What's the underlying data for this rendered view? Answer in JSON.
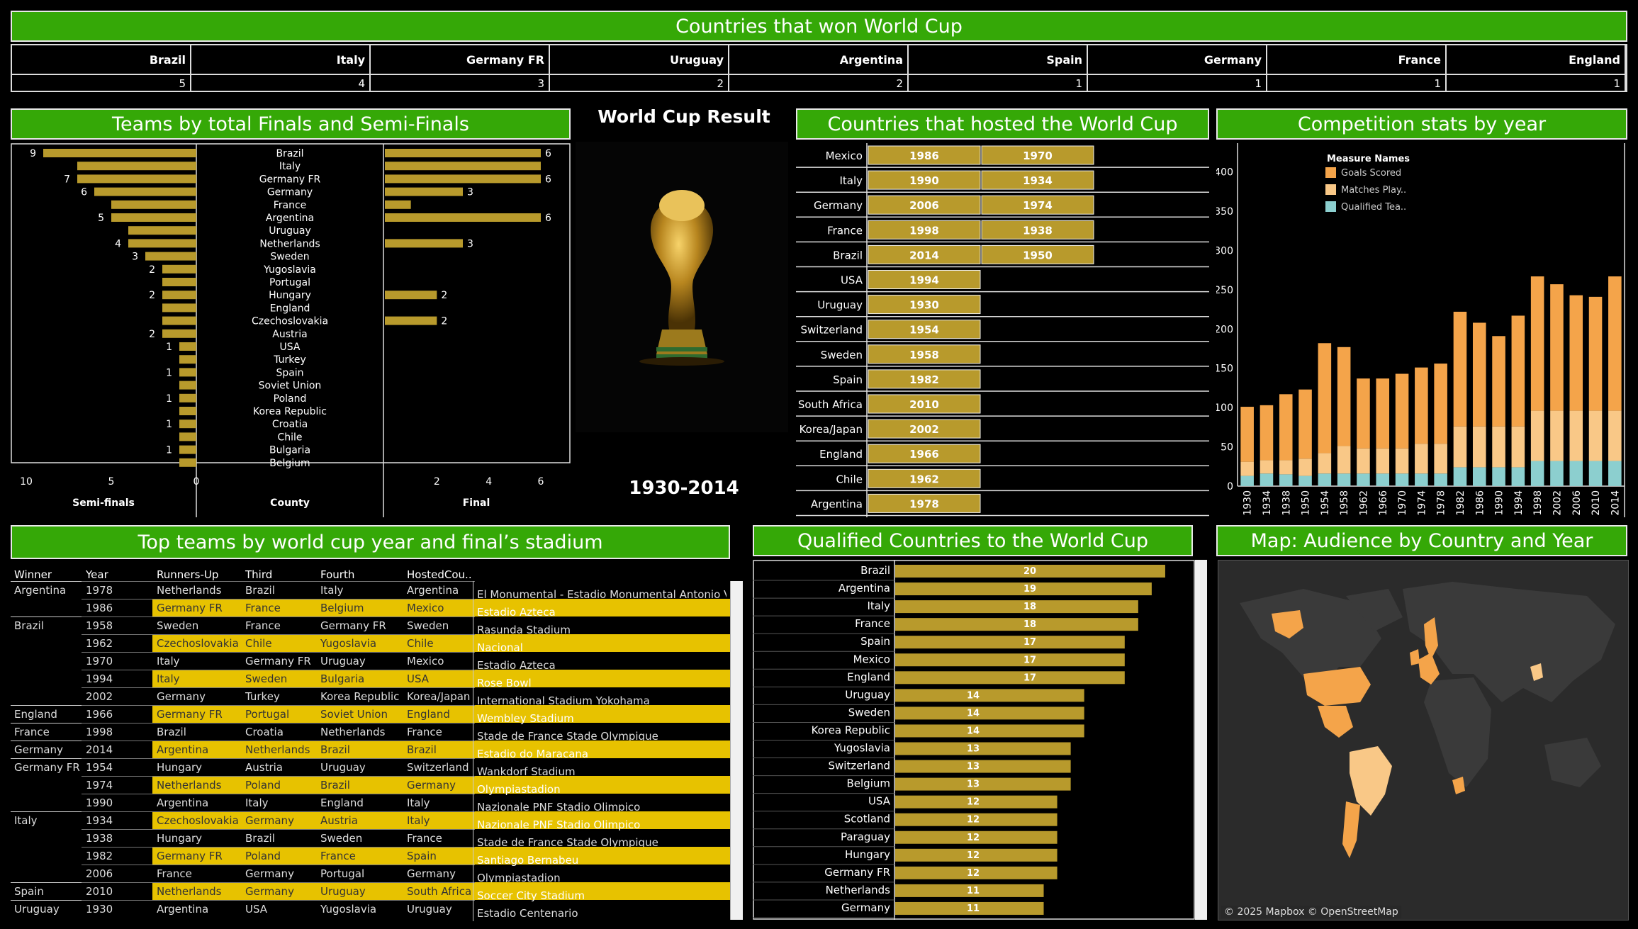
{
  "banners": {
    "won": "Countries that won World Cup",
    "finals": "Teams by total Finals and Semi-Finals",
    "hosted": "Countries that hosted the World Cup",
    "stats": "Competition stats by year",
    "topteams": "Top teams by world cup year and final’s stadium",
    "qualified": "Qualified Countries to the World Cup",
    "map": "Map: Audience by Country and Year"
  },
  "winners": [
    {
      "country": "Brazil",
      "titles": "5"
    },
    {
      "country": "Italy",
      "titles": "4"
    },
    {
      "country": "Germany FR",
      "titles": "3"
    },
    {
      "country": "Uruguay",
      "titles": "2"
    },
    {
      "country": "Argentina",
      "titles": "2"
    },
    {
      "country": "Spain",
      "titles": "1"
    },
    {
      "country": "Germany",
      "titles": "1"
    },
    {
      "country": "France",
      "titles": "1"
    },
    {
      "country": "England",
      "titles": "1"
    }
  ],
  "world_cup_result": {
    "title": "World Cup Result",
    "years": "1930-2014"
  },
  "map": {
    "credit": "© 2025 Mapbox © OpenStreetMap"
  },
  "top_teams": {
    "headers": [
      "Winner",
      "Year",
      "Runners-Up",
      "Third",
      "Fourth",
      "HostedCou.."
    ],
    "rows": [
      {
        "winner": "Argentina",
        "year": "1978",
        "runner": "Netherlands",
        "third": "Brazil",
        "fourth": "Italy",
        "host": "Argentina",
        "stadium": "El Monumental - Estadio Monumental Antonio V...",
        "hl": false,
        "sep": true
      },
      {
        "winner": "",
        "year": "1986",
        "runner": "Germany FR",
        "third": "France",
        "fourth": "Belgium",
        "host": "Mexico",
        "stadium": "Estadio Azteca",
        "hl": true,
        "sep": false
      },
      {
        "winner": "Brazil",
        "year": "1958",
        "runner": "Sweden",
        "third": "France",
        "fourth": "Germany FR",
        "host": "Sweden",
        "stadium": "Rasunda Stadium",
        "hl": false,
        "sep": true
      },
      {
        "winner": "",
        "year": "1962",
        "runner": "Czechoslovakia",
        "third": "Chile",
        "fourth": "Yugoslavia",
        "host": "Chile",
        "stadium": "Nacional",
        "hl": true,
        "sep": false
      },
      {
        "winner": "",
        "year": "1970",
        "runner": "Italy",
        "third": "Germany FR",
        "fourth": "Uruguay",
        "host": "Mexico",
        "stadium": "Estadio Azteca",
        "hl": false,
        "sep": false
      },
      {
        "winner": "",
        "year": "1994",
        "runner": "Italy",
        "third": "Sweden",
        "fourth": "Bulgaria",
        "host": "USA",
        "stadium": "Rose Bowl",
        "hl": true,
        "sep": false
      },
      {
        "winner": "",
        "year": "2002",
        "runner": "Germany",
        "third": "Turkey",
        "fourth": "Korea Republic",
        "host": "Korea/Japan",
        "stadium": "International Stadium Yokohama",
        "hl": false,
        "sep": false
      },
      {
        "winner": "England",
        "year": "1966",
        "runner": "Germany FR",
        "third": "Portugal",
        "fourth": "Soviet Union",
        "host": "England",
        "stadium": "Wembley Stadium",
        "hl": true,
        "sep": true
      },
      {
        "winner": "France",
        "year": "1998",
        "runner": "Brazil",
        "third": "Croatia",
        "fourth": "Netherlands",
        "host": "France",
        "stadium": "Stade de France  Stade Olympique",
        "hl": false,
        "sep": true
      },
      {
        "winner": "Germany",
        "year": "2014",
        "runner": "Argentina",
        "third": "Netherlands",
        "fourth": "Brazil",
        "host": "Brazil",
        "stadium": "Estadio do Maracana",
        "hl": true,
        "sep": true
      },
      {
        "winner": "Germany FR",
        "year": "1954",
        "runner": "Hungary",
        "third": "Austria",
        "fourth": "Uruguay",
        "host": "Switzerland",
        "stadium": "Wankdorf Stadium",
        "hl": false,
        "sep": true
      },
      {
        "winner": "",
        "year": "1974",
        "runner": "Netherlands",
        "third": "Poland",
        "fourth": "Brazil",
        "host": "Germany",
        "stadium": "Olympiastadion",
        "hl": true,
        "sep": false
      },
      {
        "winner": "",
        "year": "1990",
        "runner": "Argentina",
        "third": "Italy",
        "fourth": "England",
        "host": "Italy",
        "stadium": "Nazionale PNF  Stadio Olimpico",
        "hl": false,
        "sep": false
      },
      {
        "winner": "Italy",
        "year": "1934",
        "runner": "Czechoslovakia",
        "third": "Germany",
        "fourth": "Austria",
        "host": "Italy",
        "stadium": "Nazionale PNF  Stadio Olimpico",
        "hl": true,
        "sep": true
      },
      {
        "winner": "",
        "year": "1938",
        "runner": "Hungary",
        "third": "Brazil",
        "fourth": "Sweden",
        "host": "France",
        "stadium": "Stade de France  Stade Olympique",
        "hl": false,
        "sep": false
      },
      {
        "winner": "",
        "year": "1982",
        "runner": "Germany FR",
        "third": "Poland",
        "fourth": "France",
        "host": "Spain",
        "stadium": "Santiago Bernabeu",
        "hl": true,
        "sep": false
      },
      {
        "winner": "",
        "year": "2006",
        "runner": "France",
        "third": "Germany",
        "fourth": "Portugal",
        "host": "Germany",
        "stadium": "Olympiastadion",
        "hl": false,
        "sep": false
      },
      {
        "winner": "Spain",
        "year": "2010",
        "runner": "Netherlands",
        "third": "Germany",
        "fourth": "Uruguay",
        "host": "South Africa",
        "stadium": "Soccer City Stadium",
        "hl": true,
        "sep": true
      },
      {
        "winner": "Uruguay",
        "year": "1930",
        "runner": "Argentina",
        "third": "USA",
        "fourth": "Yugoslavia",
        "host": "Uruguay",
        "stadium": "Estadio Centenario",
        "hl": false,
        "sep": true
      }
    ]
  },
  "chart_data": [
    {
      "type": "bar",
      "title": "Teams by total Finals and Semi-Finals",
      "xlabel_left": "Semi-finals",
      "xlabel_mid": "County",
      "xlabel_right": "Final",
      "categories": [
        "Brazil",
        "Italy",
        "Germany FR",
        "Germany",
        "France",
        "Argentina",
        "Uruguay",
        "Netherlands",
        "Sweden",
        "Yugoslavia",
        "Portugal",
        "Hungary",
        "England",
        "Czechoslovakia",
        "Austria",
        "USA",
        "Turkey",
        "Spain",
        "Soviet Union",
        "Poland",
        "Korea Republic",
        "Croatia",
        "Chile",
        "Bulgaria",
        "Belgium"
      ],
      "series": [
        {
          "name": "Semi-finals",
          "values": [
            9,
            7,
            7,
            6,
            5,
            5,
            4,
            4,
            3,
            2,
            2,
            2,
            2,
            2,
            2,
            1,
            1,
            1,
            1,
            1,
            1,
            1,
            1,
            1,
            1
          ],
          "labels": [
            "9",
            "",
            "7",
            "6",
            "",
            "5",
            "",
            "4",
            "3",
            "2",
            "",
            "2",
            "",
            "",
            "2",
            "1",
            "",
            "1",
            "",
            "1",
            "",
            "1",
            "",
            "1",
            ""
          ]
        },
        {
          "name": "Final",
          "values": [
            6,
            6,
            6,
            3,
            1,
            6,
            0,
            3,
            0,
            0,
            0,
            2,
            0,
            2,
            0,
            0,
            0,
            0,
            0,
            0,
            0,
            0,
            0,
            0,
            0
          ],
          "labels": [
            "6",
            "",
            "6",
            "3",
            "",
            "6",
            "",
            "3",
            "",
            "",
            "",
            "2",
            "",
            "2",
            "",
            "",
            "",
            "",
            "",
            "",
            "",
            "",
            "",
            "",
            ""
          ]
        }
      ],
      "xticks_left": [
        "10",
        "5",
        "0"
      ],
      "xlim_left": [
        0,
        10
      ],
      "xticks_right": [
        "2",
        "4",
        "6"
      ],
      "xlim_right": [
        0,
        6
      ]
    },
    {
      "type": "table",
      "title": "Countries that hosted the World Cup",
      "rows": [
        {
          "country": "Mexico",
          "years": [
            "1986",
            "1970"
          ]
        },
        {
          "country": "Italy",
          "years": [
            "1990",
            "1934"
          ]
        },
        {
          "country": "Germany",
          "years": [
            "2006",
            "1974"
          ]
        },
        {
          "country": "France",
          "years": [
            "1998",
            "1938"
          ]
        },
        {
          "country": "Brazil",
          "years": [
            "2014",
            "1950"
          ]
        },
        {
          "country": "USA",
          "years": [
            "1994"
          ]
        },
        {
          "country": "Uruguay",
          "years": [
            "1930"
          ]
        },
        {
          "country": "Switzerland",
          "years": [
            "1954"
          ]
        },
        {
          "country": "Sweden",
          "years": [
            "1958"
          ]
        },
        {
          "country": "Spain",
          "years": [
            "1982"
          ]
        },
        {
          "country": "South Africa",
          "years": [
            "2010"
          ]
        },
        {
          "country": "Korea/Japan",
          "years": [
            "2002"
          ]
        },
        {
          "country": "England",
          "years": [
            "1966"
          ]
        },
        {
          "country": "Chile",
          "years": [
            "1962"
          ]
        },
        {
          "country": "Argentina",
          "years": [
            "1978"
          ]
        }
      ]
    },
    {
      "type": "bar",
      "title": "Competition stats by year",
      "legend_title": "Measure Names",
      "legend_labels": [
        "Goals Scored",
        "Matches Play..",
        "Qualified Tea.."
      ],
      "categories": [
        "1930",
        "1934",
        "1938",
        "1950",
        "1954",
        "1958",
        "1962",
        "1966",
        "1970",
        "1974",
        "1978",
        "1982",
        "1986",
        "1990",
        "1994",
        "1998",
        "2002",
        "2006",
        "2010",
        "2014"
      ],
      "series": [
        {
          "name": "Goals Scored",
          "values": [
            70,
            70,
            84,
            88,
            140,
            126,
            89,
            89,
            95,
            97,
            102,
            146,
            132,
            115,
            141,
            171,
            161,
            147,
            145,
            171
          ],
          "color": "#f4a44a"
        },
        {
          "name": "Matches Play..",
          "values": [
            18,
            17,
            18,
            22,
            26,
            35,
            32,
            32,
            32,
            38,
            38,
            52,
            52,
            52,
            52,
            64,
            64,
            64,
            64,
            64
          ]
        },
        {
          "name": "Qualified Tea..",
          "values": [
            13,
            16,
            15,
            13,
            16,
            16,
            16,
            16,
            16,
            16,
            16,
            24,
            24,
            24,
            24,
            32,
            32,
            32,
            32,
            32
          ]
        }
      ],
      "colors": {
        "Goals Scored": "#f4a44a",
        "Matches Play..": "#f9c887",
        "Qualified Tea..": "#8ccfcf"
      },
      "yticks": [
        0,
        50,
        100,
        150,
        200,
        250,
        300,
        350,
        400
      ],
      "ylim": [
        0,
        415
      ],
      "grid": false,
      "legend": "top-left"
    },
    {
      "type": "bar",
      "title": "Qualified Countries to the World Cup",
      "categories": [
        "Brazil",
        "Argentina",
        "Italy",
        "France",
        "Spain",
        "Mexico",
        "England",
        "Uruguay",
        "Sweden",
        "Korea Republic",
        "Yugoslavia",
        "Switzerland",
        "Belgium",
        "USA",
        "Scotland",
        "Paraguay",
        "Hungary",
        "Germany FR",
        "Netherlands",
        "Germany"
      ],
      "values": [
        20,
        19,
        18,
        18,
        17,
        17,
        17,
        14,
        14,
        14,
        13,
        13,
        13,
        12,
        12,
        12,
        12,
        12,
        11,
        11
      ],
      "xlim": [
        0,
        21
      ]
    }
  ],
  "colors": {
    "banner": "#35a807",
    "bar": "#b89a2c",
    "highlight": "#e7c200",
    "background": "#000000"
  }
}
